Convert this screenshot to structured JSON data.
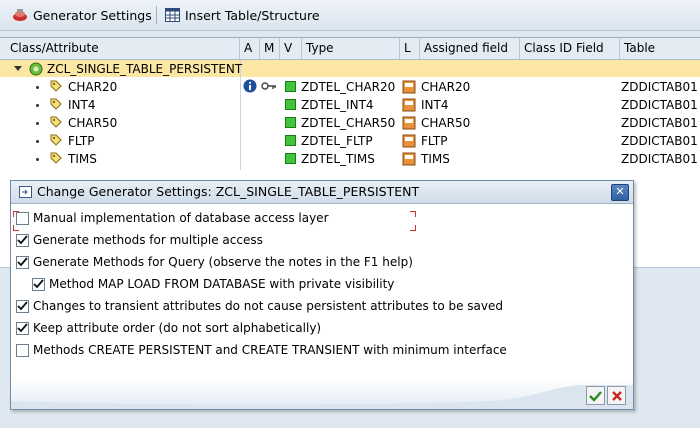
{
  "toolbar": {
    "generator_settings_label": "Generator Settings",
    "insert_table_label": "Insert Table/Structure"
  },
  "table": {
    "headers": {
      "class_attribute": "Class/Attribute",
      "a": "A",
      "m": "M",
      "v": "V",
      "type": "Type",
      "l": "L",
      "assigned_field": "Assigned field",
      "class_id_field": "Class ID Field",
      "table": "Table"
    },
    "root": {
      "name": "ZCL_SINGLE_TABLE_PERSISTENT"
    },
    "rows": [
      {
        "name": "CHAR20",
        "type": "ZDTEL_CHAR20",
        "assigned": "CHAR20",
        "table": "ZDDICTAB01"
      },
      {
        "name": "INT4",
        "type": "ZDTEL_INT4",
        "assigned": "INT4",
        "table": "ZDDICTAB01"
      },
      {
        "name": "CHAR50",
        "type": "ZDTEL_CHAR50",
        "assigned": "CHAR50",
        "table": "ZDDICTAB01"
      },
      {
        "name": "FLTP",
        "type": "ZDTEL_FLTP",
        "assigned": "FLTP",
        "table": "ZDDICTAB01"
      },
      {
        "name": "TIMS",
        "type": "ZDTEL_TIMS",
        "assigned": "TIMS",
        "table": "ZDDICTAB01"
      }
    ]
  },
  "dialog": {
    "title": "Change Generator Settings: ZCL_SINGLE_TABLE_PERSISTENT",
    "options": [
      {
        "label": "Manual implementation of database access layer",
        "checked": false
      },
      {
        "label": "Generate methods for multiple access",
        "checked": true
      },
      {
        "label": "Generate Methods for Query (observe the notes in the F1 help)",
        "checked": true
      },
      {
        "label": "Method MAP LOAD FROM DATABASE with private visibility",
        "checked": true
      },
      {
        "label": "Changes to transient attributes do not cause persistent attributes to be saved",
        "checked": true
      },
      {
        "label": "Keep attribute order (do not sort alphabetically)",
        "checked": true
      },
      {
        "label": "Methods CREATE PERSISTENT and CREATE TRANSIENT with minimum interface",
        "checked": false
      }
    ]
  },
  "colors": {
    "root_row_highlight": "#fbe7a3",
    "status_green": "#3fc43a",
    "close_button_blue": "#2f5ea3"
  }
}
